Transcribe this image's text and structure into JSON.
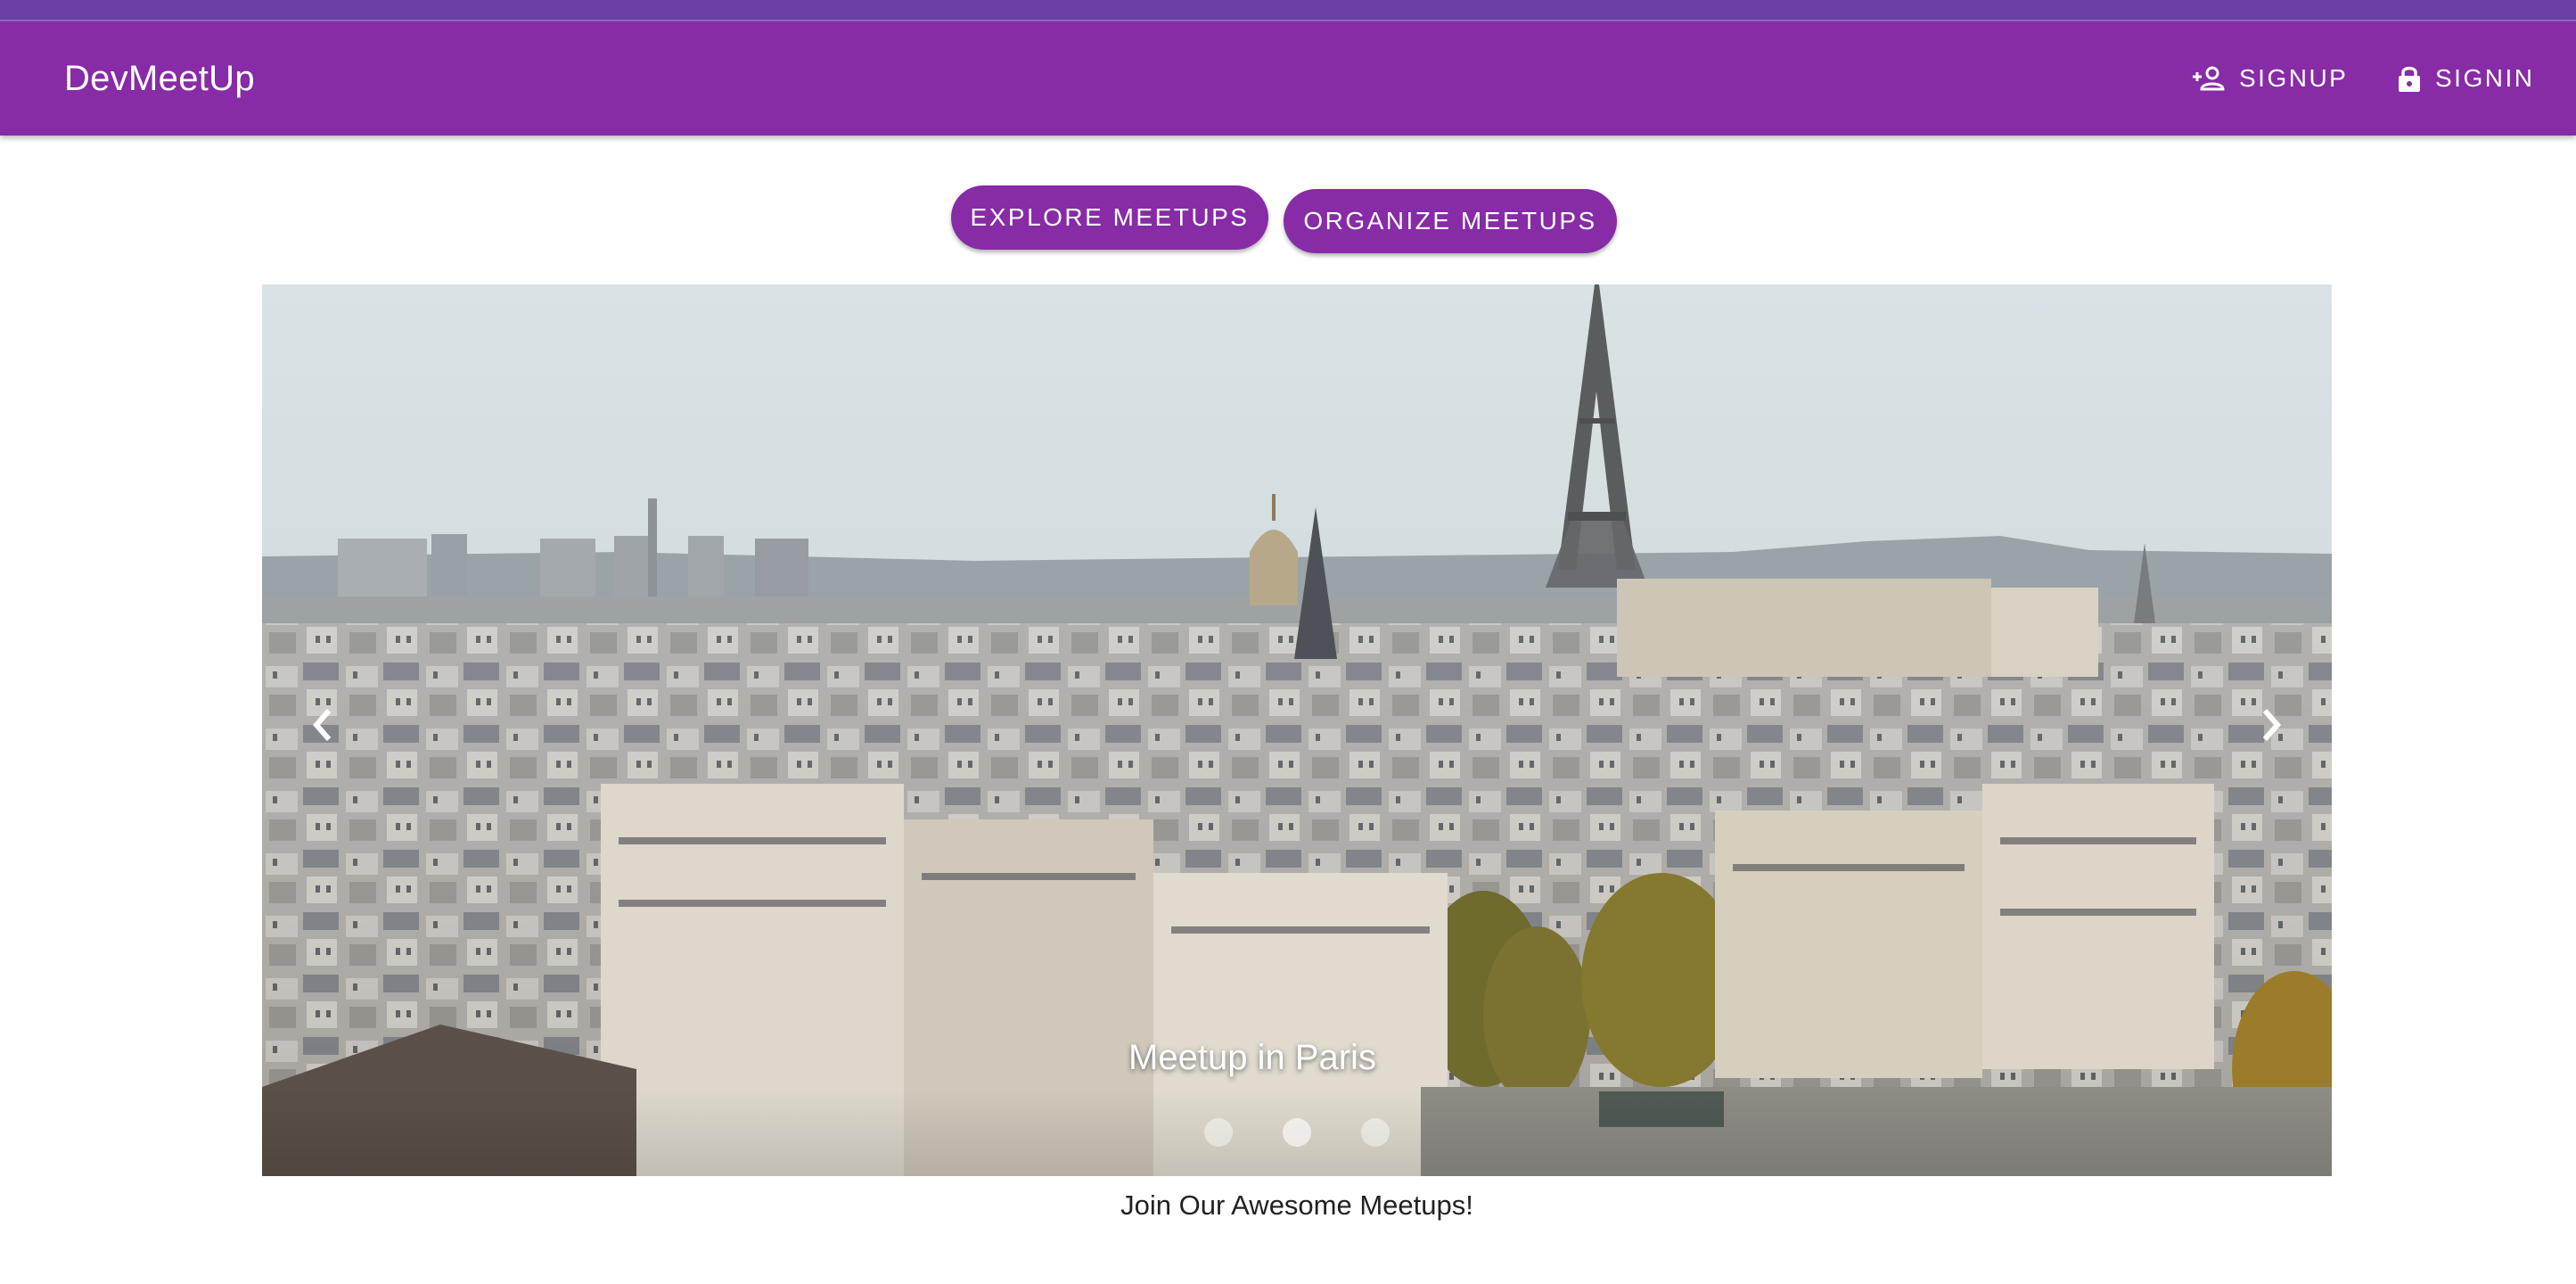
{
  "app": {
    "title": "DevMeetUp"
  },
  "toolbar": {
    "signup": {
      "label": "SIGNUP",
      "icon": "person-add-icon"
    },
    "signin": {
      "label": "SIGNIN",
      "icon": "lock-icon"
    }
  },
  "actions": {
    "explore_label": "EXPLORE MEETUPS",
    "organize_label": "ORGANIZE MEETUPS"
  },
  "carousel": {
    "caption": "Meetup in Paris",
    "slide_count": 3,
    "active_index": 1,
    "prev_icon": "chevron-left-icon",
    "next_icon": "chevron-right-icon"
  },
  "footer": {
    "tagline": "Join Our Awesome Meetups!"
  },
  "colors": {
    "primary": "#872ba7",
    "topstrip": "#6a40a6"
  }
}
